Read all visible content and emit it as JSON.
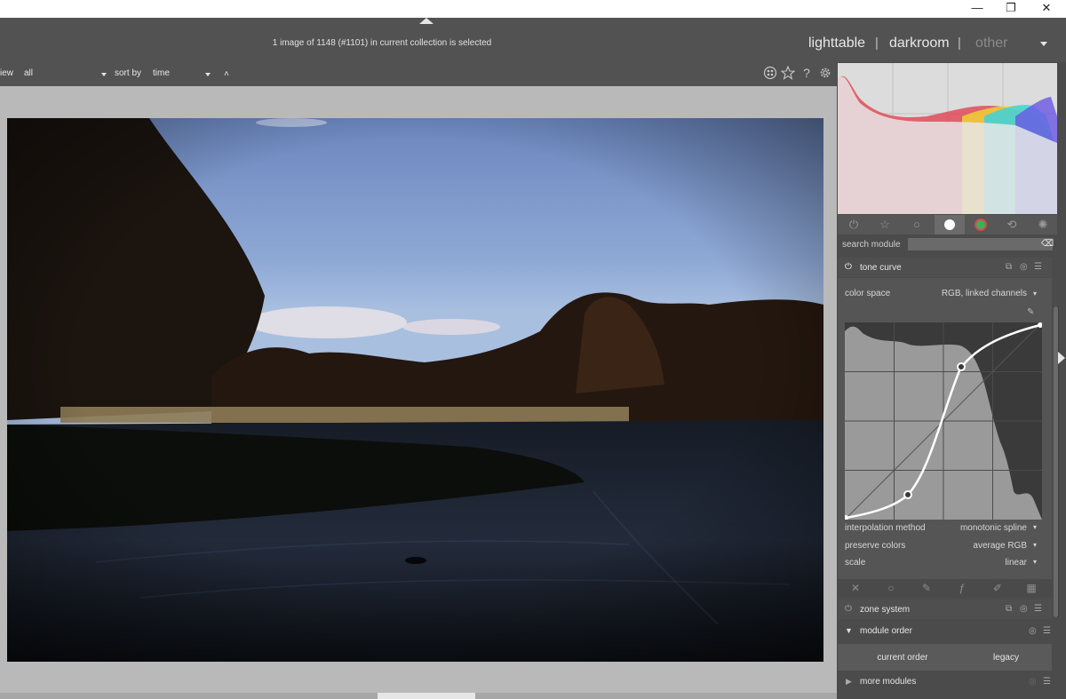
{
  "window": {
    "minimize_glyph": "—",
    "restore_glyph": "❐",
    "close_glyph": "✕"
  },
  "header": {
    "selection_info": "1 image of 1148 (#1101) in current collection is selected",
    "views": {
      "lighttable": "lighttable",
      "darkroom": "darkroom",
      "other": "other",
      "sep": "|"
    }
  },
  "filterbar": {
    "view_label": "iew",
    "view_value": "all",
    "sort_label": "sort by",
    "sort_value": "time",
    "sort_dir": "˄"
  },
  "icons": {
    "grouping": "grouping-icon",
    "star": "star-icon",
    "help": "help-icon",
    "preferences": "gear-icon"
  },
  "module_groups": [
    "power-icon",
    "star-icon",
    "circle-icon",
    "tone-icon",
    "color-icon",
    "correct-icon",
    "effect-icon"
  ],
  "search": {
    "label": "search module",
    "placeholder": "",
    "clear_glyph": "⌫"
  },
  "tone_curve": {
    "title": "tone curve",
    "color_space_label": "color space",
    "color_space_value": "RGB, linked channels",
    "interpolation_label": "interpolation method",
    "interpolation_value": "monotonic spline",
    "preserve_label": "preserve colors",
    "preserve_value": "average RGB",
    "scale_label": "scale",
    "scale_value": "linear",
    "dropdown_glyph": "▾"
  },
  "zone_system": {
    "title": "zone system"
  },
  "module_order": {
    "title": "module order",
    "current": "current order",
    "preset": "legacy"
  },
  "more_modules": {
    "title": "more modules"
  },
  "colors": {
    "panel": "#4b4b4b",
    "header": "#525252",
    "center": "#b9b9b9",
    "curve_line": "#ffffff"
  }
}
